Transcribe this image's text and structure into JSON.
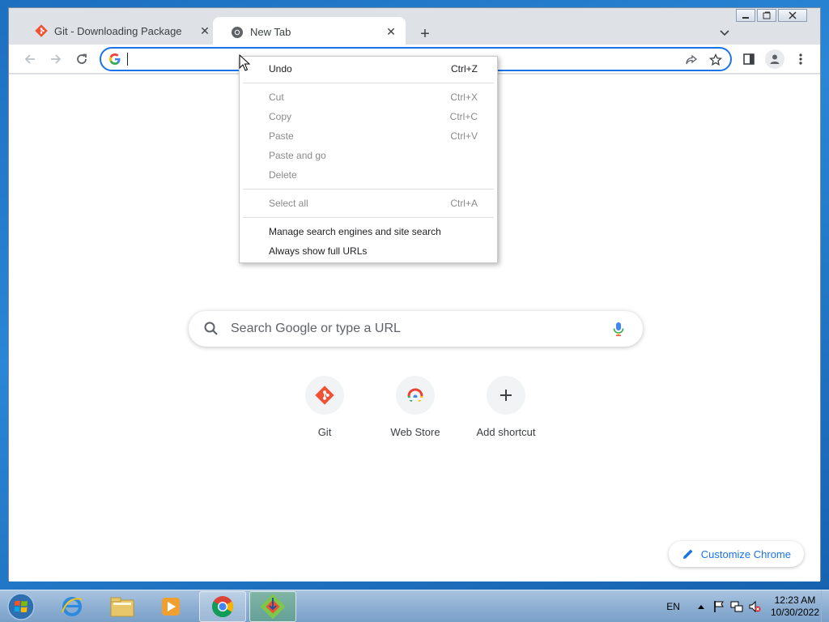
{
  "browser": {
    "tabs": [
      {
        "title": "Git - Downloading Package",
        "icon": "git-icon",
        "active": false
      },
      {
        "title": "New Tab",
        "icon": "chrome-icon",
        "active": true
      }
    ],
    "new_tab_symbol": "+",
    "omnibox": {
      "value": "",
      "placeholder": ""
    }
  },
  "context_menu": {
    "groups": [
      [
        {
          "label": "Undo",
          "shortcut": "Ctrl+Z",
          "enabled": true
        }
      ],
      [
        {
          "label": "Cut",
          "shortcut": "Ctrl+X",
          "enabled": false
        },
        {
          "label": "Copy",
          "shortcut": "Ctrl+C",
          "enabled": false
        },
        {
          "label": "Paste",
          "shortcut": "Ctrl+V",
          "enabled": false
        },
        {
          "label": "Paste and go",
          "shortcut": "",
          "enabled": false
        },
        {
          "label": "Delete",
          "shortcut": "",
          "enabled": false
        }
      ],
      [
        {
          "label": "Select all",
          "shortcut": "Ctrl+A",
          "enabled": false
        }
      ],
      [
        {
          "label": "Manage search engines and site search",
          "shortcut": "",
          "enabled": true
        },
        {
          "label": "Always show full URLs",
          "shortcut": "",
          "enabled": true
        }
      ]
    ]
  },
  "ntp": {
    "search_placeholder": "Search Google or type a URL",
    "shortcuts": [
      {
        "label": "Git",
        "icon": "git-icon"
      },
      {
        "label": "Web Store",
        "icon": "web-store-icon"
      },
      {
        "label": "Add shortcut",
        "icon": "plus-icon"
      }
    ],
    "customize_label": "Customize Chrome"
  },
  "taskbar": {
    "language": "EN",
    "time": "12:23 AM",
    "date": "10/30/2022"
  },
  "colors": {
    "accent": "#1a73e8",
    "git_orange": "#f05033"
  }
}
